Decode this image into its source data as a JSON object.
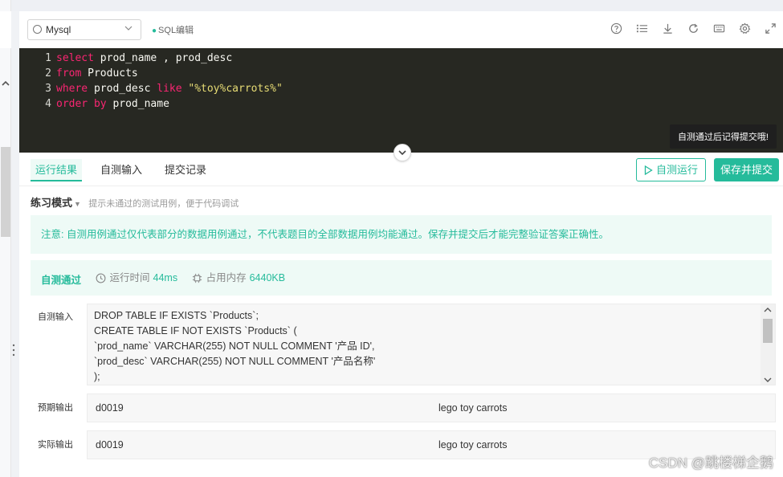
{
  "toolbar": {
    "language": "Mysql",
    "mode_tag": "SQL编辑",
    "icons": [
      "help-icon",
      "list-icon",
      "download-icon",
      "refresh-icon",
      "keyboard-icon",
      "settings-icon",
      "fullscreen-icon"
    ]
  },
  "editor": {
    "lines": [
      {
        "n": "1",
        "parts": [
          {
            "t": "select",
            "c": "kw"
          },
          {
            "t": " prod_name , prod_desc",
            "c": "id"
          }
        ]
      },
      {
        "n": "2",
        "parts": [
          {
            "t": "from",
            "c": "kw"
          },
          {
            "t": " Products",
            "c": "id"
          }
        ]
      },
      {
        "n": "3",
        "parts": [
          {
            "t": "where",
            "c": "kw"
          },
          {
            "t": " prod_desc ",
            "c": "id"
          },
          {
            "t": "like",
            "c": "kw"
          },
          {
            "t": " ",
            "c": "id"
          },
          {
            "t": "\"%toy%carrots%\"",
            "c": "str"
          }
        ]
      },
      {
        "n": "4",
        "parts": [
          {
            "t": "order by",
            "c": "kw"
          },
          {
            "t": " prod_name",
            "c": "id"
          }
        ]
      }
    ],
    "tooltip": "自测通过后记得提交哦!"
  },
  "tabs": [
    {
      "label": "运行结果",
      "active": true
    },
    {
      "label": "自测输入",
      "active": false
    },
    {
      "label": "提交记录",
      "active": false
    }
  ],
  "actions": {
    "run_label": "自测运行",
    "submit_label": "保存并提交"
  },
  "mode": {
    "title": "练习模式",
    "hint": "提示未通过的测试用例，便于代码调试"
  },
  "notice": "注意: 自测用例通过仅代表部分的数据用例通过，不代表题目的全部数据用例均能通过。保存并提交后才能完整验证答案正确性。",
  "result": {
    "status": "自测通过",
    "runtime_label": "运行时间",
    "runtime_value": "44ms",
    "memory_label": "占用内存",
    "memory_value": "6440KB"
  },
  "io": {
    "input_label": "自测输入",
    "input_lines": [
      "DROP TABLE IF EXISTS `Products`;",
      "CREATE TABLE IF NOT EXISTS `Products` (",
      "`prod_name` VARCHAR(255) NOT NULL COMMENT '产品 ID',",
      "`prod_desc` VARCHAR(255) NOT NULL COMMENT '产品名称'",
      ");"
    ],
    "expected_label": "预期输出",
    "expected": [
      "d0019",
      "lego toy carrots"
    ],
    "actual_label": "实际输出",
    "actual": [
      "d0019",
      "lego toy carrots"
    ]
  },
  "watermark": "CSDN @跳楼梯企鹅"
}
